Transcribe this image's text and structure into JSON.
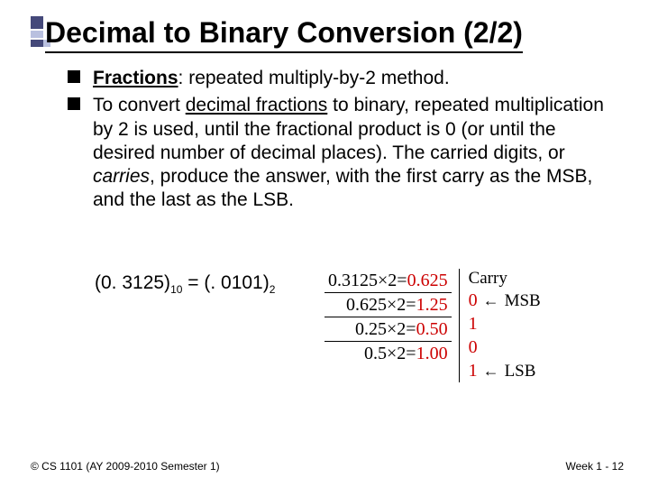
{
  "title": "Decimal to Binary Conversion (2/2)",
  "bullets": {
    "b1_strong": "Fractions",
    "b1_rest": ": repeated multiply-by-2 method.",
    "b2_a": "To convert ",
    "b2_ul": "decimal fractions",
    "b2_b": " to binary, repeated multiplication by 2 is used, until the fractional product is 0 (or until the desired number of decimal places). The carried digits, or ",
    "b2_it": "carries",
    "b2_c": ", produce the answer, with the first carry as the MSB, and the last as the LSB."
  },
  "equation": {
    "lhs": "(0. 3125)",
    "lhs_sub": "10",
    "mid": " = (. 0101)",
    "rhs_sub": "2"
  },
  "chart_data": {
    "type": "table",
    "header_carry": "Carry",
    "rows": [
      {
        "calc_pre": "0.3125×2=",
        "calc_res": "0.625",
        "carry": "0",
        "note": "MSB"
      },
      {
        "calc_pre": "0.625×2=",
        "calc_res": "1.25",
        "carry": "1",
        "note": ""
      },
      {
        "calc_pre": "0.25×2=",
        "calc_res": "0.50",
        "carry": "0",
        "note": ""
      },
      {
        "calc_pre": "0.5×2=",
        "calc_res": "1.00",
        "carry": "1",
        "note": "LSB"
      }
    ],
    "arrow_glyph": "←"
  },
  "footer": {
    "left": "© CS 1101 (AY 2009-2010 Semester 1)",
    "right": "Week 1 - 12"
  }
}
